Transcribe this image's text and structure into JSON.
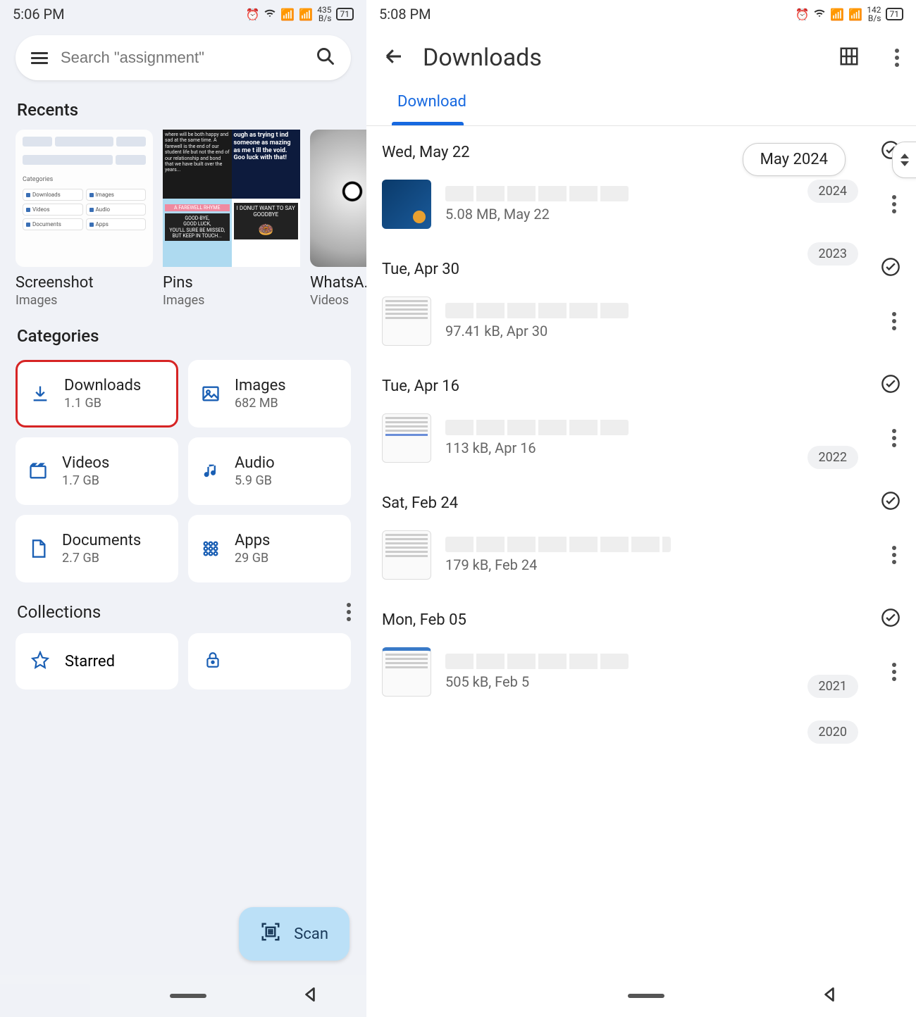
{
  "left": {
    "status": {
      "time": "5:06 PM",
      "speed_top": "435",
      "speed_bottom": "B/s",
      "battery": "71"
    },
    "search_placeholder": "Search \"assignment\"",
    "recents_title": "Recents",
    "recents": [
      {
        "name": "Screenshot",
        "type": "Images"
      },
      {
        "name": "Pins",
        "type": "Images"
      },
      {
        "name": "WhatsApp",
        "type": "Videos"
      }
    ],
    "pins_text": {
      "p2": "ough as trying t ind someone as mazing as me t ill the void. Goo luck with that!",
      "p3_title": "A FAREWELL RHYME",
      "p3_lines": "GOOD-BYE,\nGOOD LUCK,\nYOU'LL SURE BE MISSED,\nBUT KEEP IN TOUCH...",
      "p4": "I DONUT WANT TO SAY GOODBYE"
    },
    "categories_title": "Categories",
    "categories": [
      {
        "name": "Downloads",
        "size": "1.1 GB",
        "highlight": true
      },
      {
        "name": "Images",
        "size": "682 MB"
      },
      {
        "name": "Videos",
        "size": "1.7 GB"
      },
      {
        "name": "Audio",
        "size": "5.9 GB"
      },
      {
        "name": "Documents",
        "size": "2.7 GB"
      },
      {
        "name": "Apps",
        "size": "29 GB"
      }
    ],
    "collections_title": "Collections",
    "starred": "Starred",
    "scan": "Scan"
  },
  "right": {
    "status": {
      "time": "5:08 PM",
      "speed_top": "142",
      "speed_bottom": "B/s",
      "battery": "71"
    },
    "title": "Downloads",
    "tab": "Download",
    "month_chip": "May 2024",
    "years": [
      "2024",
      "2023",
      "2022",
      "2021",
      "2020"
    ],
    "groups": [
      {
        "date": "Wed, May 22",
        "file_meta": "5.08 MB, May 22",
        "thumb": "cert"
      },
      {
        "date": "Tue, Apr 30",
        "file_meta": "97.41 kB, Apr 30",
        "thumb": "doc"
      },
      {
        "date": "Tue, Apr 16",
        "file_meta": "113 kB, Apr 16",
        "thumb": "doc"
      },
      {
        "date": "Sat, Feb 24",
        "file_meta": "179 kB, Feb 24",
        "thumb": "doc"
      },
      {
        "date": "Mon, Feb 05",
        "file_meta": "505 kB, Feb 5",
        "thumb": "bluedoc"
      }
    ]
  }
}
